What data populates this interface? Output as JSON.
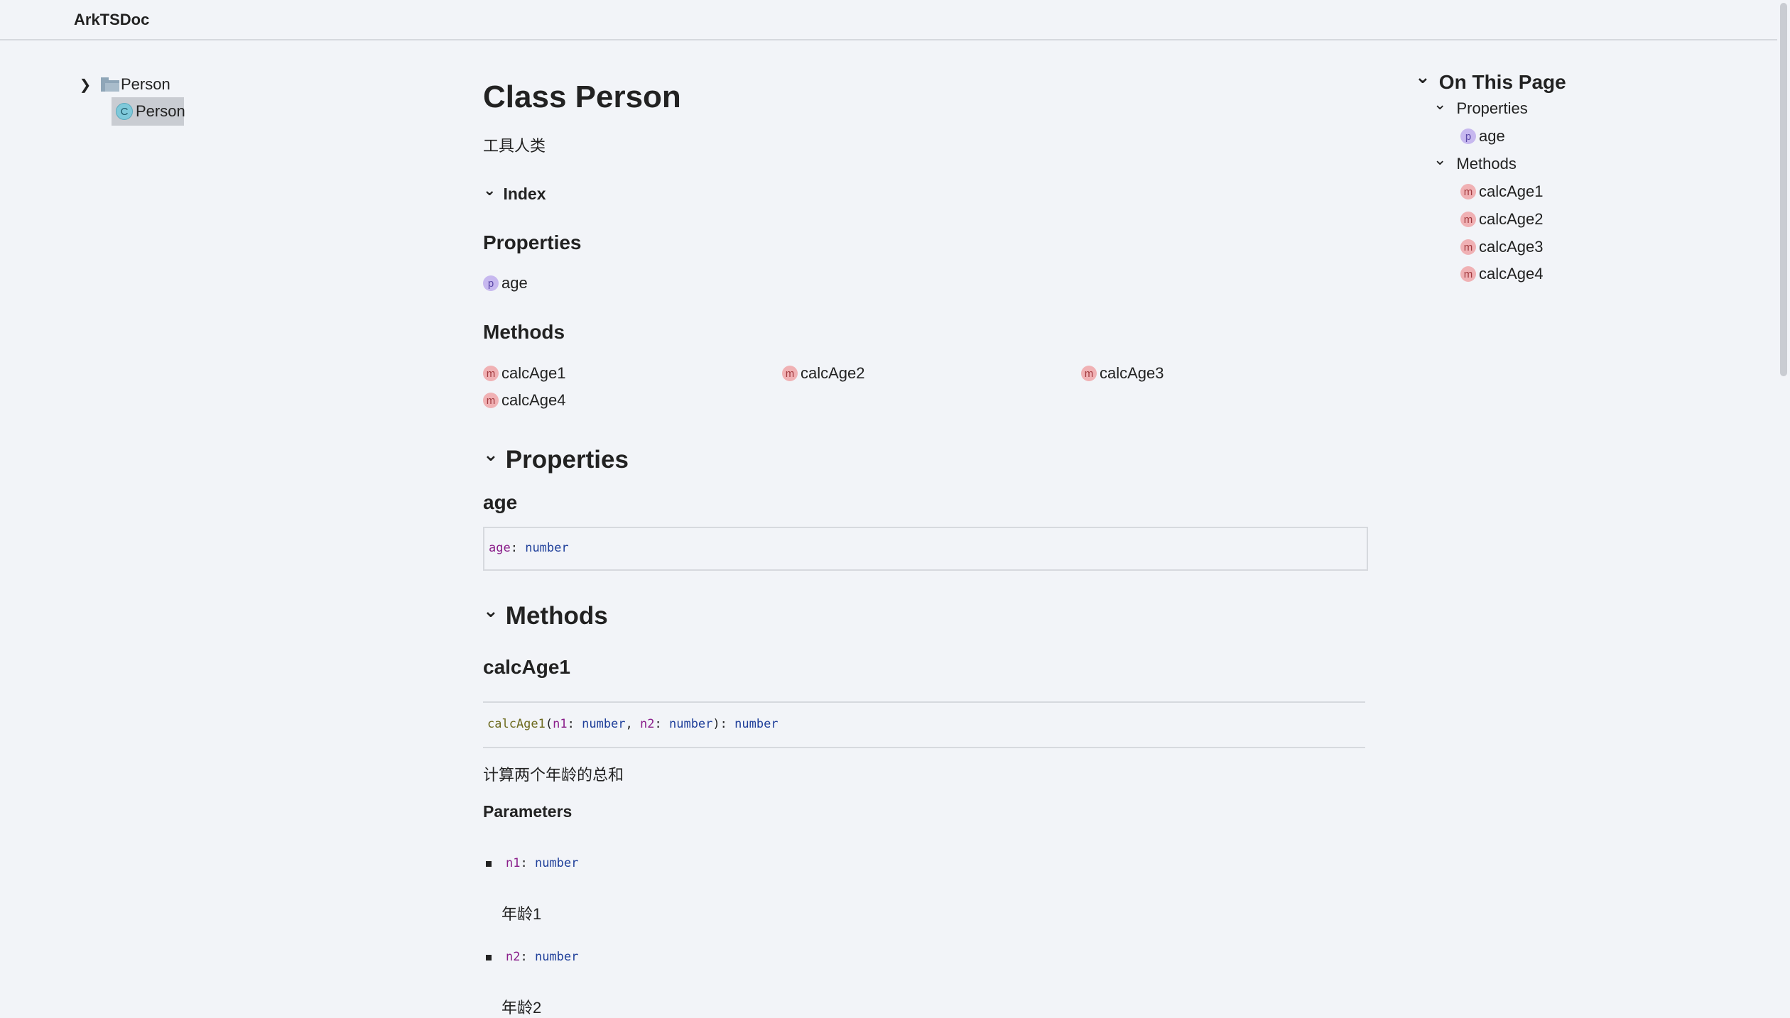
{
  "header": {
    "brand": "ArkTSDoc"
  },
  "sidebar": {
    "folder_label": "Person",
    "class_label": "Person",
    "class_kind": "C"
  },
  "main": {
    "title": "Class Person",
    "description": "工具人类",
    "index_heading": "Index",
    "index_properties_heading": "Properties",
    "index_properties": [
      {
        "kind": "p",
        "label": "age"
      }
    ],
    "index_methods_heading": "Methods",
    "index_methods": [
      {
        "kind": "m",
        "label": "calcAge1"
      },
      {
        "kind": "m",
        "label": "calcAge2"
      },
      {
        "kind": "m",
        "label": "calcAge3"
      },
      {
        "kind": "m",
        "label": "calcAge4"
      }
    ],
    "properties_section_heading": "Properties",
    "property": {
      "name": "age",
      "signature_name": "age",
      "signature_sep": ": ",
      "signature_type": "number"
    },
    "methods_section_heading": "Methods",
    "method": {
      "name": "calcAge1",
      "sig_fn": "calcAge1",
      "sig_open": "(",
      "sig_p1": "n1",
      "sig_colon1": ": ",
      "sig_t1": "number",
      "sig_comma": ", ",
      "sig_p2": "n2",
      "sig_colon2": ": ",
      "sig_t2": "number",
      "sig_close": "): ",
      "sig_ret": "number",
      "description": "计算两个年龄的总和",
      "parameters_heading": "Parameters",
      "params": [
        {
          "name": "n1",
          "sep": ": ",
          "type": "number",
          "desc": "年龄1"
        },
        {
          "name": "n2",
          "sep": ": ",
          "type": "number",
          "desc": "年龄2"
        }
      ]
    }
  },
  "toc": {
    "title": "On This Page",
    "properties_label": "Properties",
    "properties": [
      {
        "kind": "p",
        "label": "age"
      }
    ],
    "methods_label": "Methods",
    "methods": [
      {
        "kind": "m",
        "label": "calcAge1"
      },
      {
        "kind": "m",
        "label": "calcAge2"
      },
      {
        "kind": "m",
        "label": "calcAge3"
      },
      {
        "kind": "m",
        "label": "calcAge4"
      }
    ]
  },
  "icons": {
    "chevron_right": "❯",
    "chevron_down": "⌄"
  }
}
